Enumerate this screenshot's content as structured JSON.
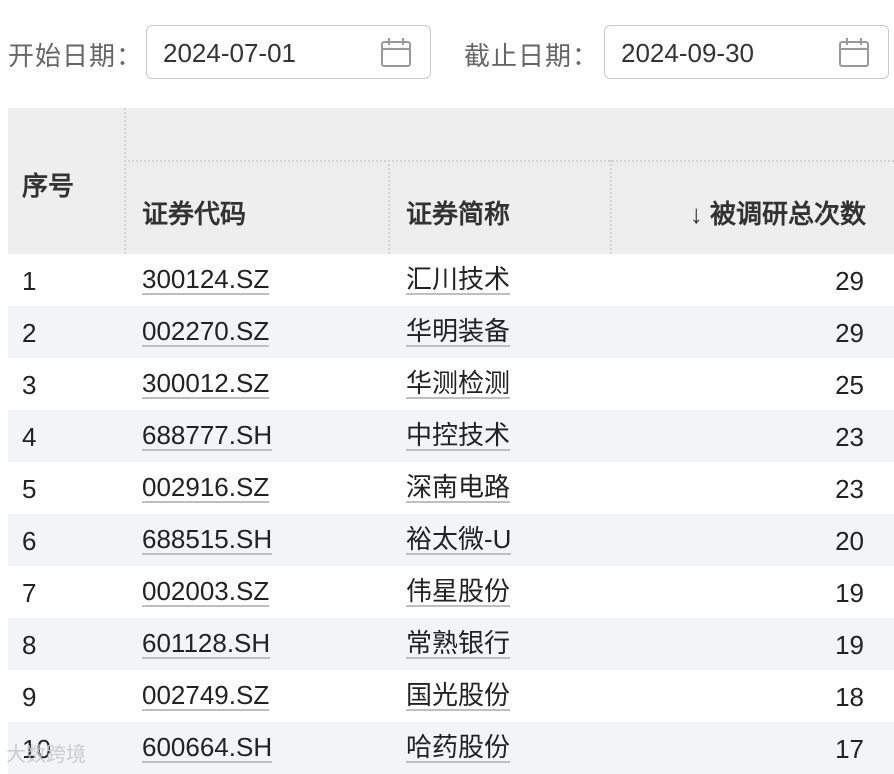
{
  "filters": {
    "start_label": "开始日期：",
    "start_value": "2024-07-01",
    "end_label": "截止日期：",
    "end_value": "2024-09-30"
  },
  "table": {
    "headers": {
      "seq": "序号",
      "code": "证券代码",
      "name": "证券简称",
      "count": "↓ 被调研总次数"
    },
    "rows": [
      {
        "seq": "1",
        "code": "300124.SZ",
        "name": "汇川技术",
        "count": "29"
      },
      {
        "seq": "2",
        "code": "002270.SZ",
        "name": "华明装备",
        "count": "29"
      },
      {
        "seq": "3",
        "code": "300012.SZ",
        "name": "华测检测",
        "count": "25"
      },
      {
        "seq": "4",
        "code": "688777.SH",
        "name": "中控技术",
        "count": "23"
      },
      {
        "seq": "5",
        "code": "002916.SZ",
        "name": "深南电路",
        "count": "23"
      },
      {
        "seq": "6",
        "code": "688515.SH",
        "name": "裕太微-U",
        "count": "20"
      },
      {
        "seq": "7",
        "code": "002003.SZ",
        "name": "伟星股份",
        "count": "19"
      },
      {
        "seq": "8",
        "code": "601128.SH",
        "name": "常熟银行",
        "count": "19"
      },
      {
        "seq": "9",
        "code": "002749.SZ",
        "name": "国光股份",
        "count": "18"
      },
      {
        "seq": "10",
        "code": "600664.SH",
        "name": "哈药股份",
        "count": "17"
      }
    ]
  },
  "watermark": "大数跨境",
  "icons": {
    "calendar": "calendar-icon",
    "sort": "sort-down-arrow"
  },
  "colors": {
    "header_bg": "#eeeeee",
    "alt_row_bg": "#f2f4f5",
    "link_underline": "#bfbfbf"
  }
}
